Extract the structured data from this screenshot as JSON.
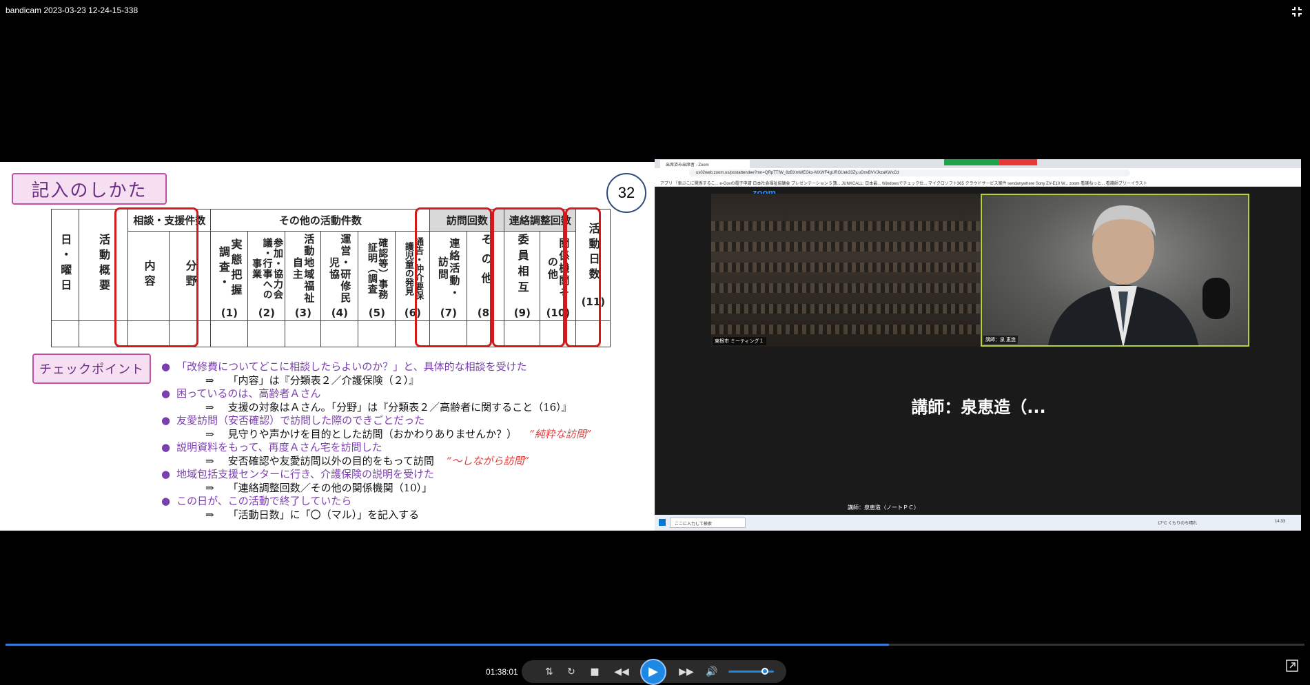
{
  "window": {
    "title": "bandicam 2023-03-23 12-24-15-338"
  },
  "slide": {
    "title": "記入のしかた",
    "page_number": "32",
    "table": {
      "groups": {
        "consult": "相談・支援件数",
        "other": "その他の活動件数",
        "visit": "訪問回数",
        "liaison": "連絡調整回数"
      },
      "col_date": "日・曜日",
      "col_summary": "活動概要",
      "col_naiyou": "内容",
      "col_bunya": "分野",
      "c1": {
        "text": "実態把握調査・",
        "num": "(1)"
      },
      "c2": {
        "text": "参加・協力会議・行事への事業",
        "num": "(2)"
      },
      "c3": {
        "text": "活動地域福祉自主",
        "num": "(3)"
      },
      "c4": {
        "text": "運営・研修民児協",
        "num": "(4)"
      },
      "c5": {
        "text": "確認等）事務証明（調査",
        "num": "(5)"
      },
      "c6": {
        "text": "通告・仲介要保護児童の発見",
        "num": "(6)"
      },
      "c7": {
        "text": "連絡活動・訪問",
        "num": "(7)"
      },
      "c8": {
        "text": "その他",
        "num": "(8)"
      },
      "c9": {
        "text": "委員相互",
        "num": "(9)"
      },
      "c10": {
        "text": "関係機関その他",
        "num": "(10)"
      },
      "c11": {
        "text": "活動日数",
        "num": "(11)"
      }
    },
    "checkpoint_label": "チェックポイント",
    "checks": [
      {
        "q": "「改修費についてどこに相談したらよいのか？」と、具体的な相談を受けた",
        "a": "「内容」は『分類表２／介護保険（２）』",
        "note": ""
      },
      {
        "q": "困っているのは、高齢者Ａさん",
        "a": "支援の対象はＡさん。「分野」は『分類表２／高齢者に関すること（16）』",
        "note": ""
      },
      {
        "q": "友愛訪問（安否確認）で訪問した際のできごとだった",
        "a": "見守りや声かけを目的とした訪問（おかわりありませんか？）",
        "note": "“純粋な訪問”"
      },
      {
        "q": "説明資料をもって、再度Ａさん宅を訪問した",
        "a": "安否確認や友愛訪問以外の目的をもって訪問",
        "note": "“～しながら訪問”"
      },
      {
        "q": "地域包括支援センターに行き、介護保険の説明を受けた",
        "a": "「連絡調整回数／その他の関係機関（10）」",
        "note": ""
      },
      {
        "q": "この日が、この活動で終了していたら",
        "a": "「活動日数」に「〇（マル）」を記入する",
        "note": ""
      }
    ],
    "arrow": "⇒"
  },
  "zoom": {
    "tab_label": "出席済み出席者 - Zoom",
    "url": "us02web.zoom.us/postattendee?mn=QRpTTIW_8zBXmWEGks-MXWF4gURGUek33Zy.uOnvBVVJkzaKWxCd",
    "bookmarks": "アプリ   「車ぶこに関係するこ...   e-Govの電子申請   日本社会福祉協議会   プレゼンテーション 5 簿...   JUNKCALL: 日本最...   Windowsでチェック仕...   マイクロソフト365   クラウドサービス案件   sendanywhere   Sony   ZV-E10   W...   zoom   看護ねっと...   看護師ブリーイラスト",
    "logo": "zoom",
    "audience_label": "東根市 ミーティング１",
    "speaker_label": "講師：泉 恵造",
    "lecturer_name": "講師：泉恵造（...",
    "active_speaker_label": "講師：泉恵造（ノートＰＣ）",
    "taskbar_search": "ここに入力して検索",
    "weather": "17°C くもりのち晴れ",
    "clock": "14:33"
  },
  "player": {
    "time": "01:38:01",
    "progress": 0.68,
    "volume": 0.8
  }
}
